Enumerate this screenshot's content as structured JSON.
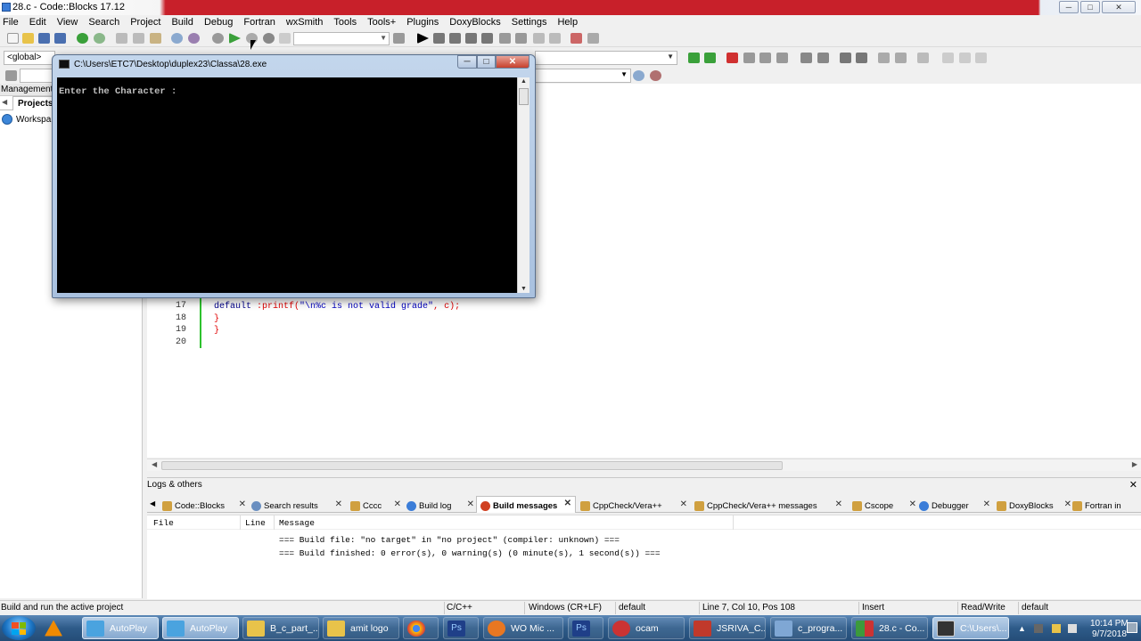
{
  "app": {
    "title": "28.c - Code::Blocks 17.12",
    "win_buttons": [
      "─",
      "□",
      "✕"
    ]
  },
  "menu": [
    "File",
    "Edit",
    "View",
    "Search",
    "Project",
    "Build",
    "Debug",
    "Fortran",
    "wxSmith",
    "Tools",
    "Tools+",
    "Plugins",
    "DoxyBlocks",
    "Settings",
    "Help"
  ],
  "toolbar": {
    "scope_value": "<global>"
  },
  "management": {
    "header": "Management",
    "tab_projects": "Projects",
    "workspace_label": "Workspa"
  },
  "editor": {
    "lines": [
      {
        "num": "17",
        "code_kw": "default",
        "code_rest": " :printf(",
        "code_str": "\"\\n%c is not valid grade\"",
        "code_end": ", c);"
      },
      {
        "num": "18",
        "brace": "}"
      },
      {
        "num": "19",
        "brace": "}"
      },
      {
        "num": "20",
        "brace": ""
      }
    ]
  },
  "logs": {
    "header": "Logs & others",
    "tabs": [
      {
        "label": "Code::Blocks",
        "icon_color": "#d0a040"
      },
      {
        "label": "Search results",
        "icon_color": "#6a8fc0"
      },
      {
        "label": "Cccc",
        "icon_color": "#d0a040"
      },
      {
        "label": "Build log",
        "icon_color": "#3b7dd8"
      },
      {
        "label": "Build messages",
        "icon_color": "#d04020"
      },
      {
        "label": "CppCheck/Vera++",
        "icon_color": "#d0a040"
      },
      {
        "label": "CppCheck/Vera++ messages",
        "icon_color": "#d0a040"
      },
      {
        "label": "Cscope",
        "icon_color": "#d0a040"
      },
      {
        "label": "Debugger",
        "icon_color": "#3b7dd8"
      },
      {
        "label": "DoxyBlocks",
        "icon_color": "#d0a040"
      },
      {
        "label": "Fortran in",
        "icon_color": "#d0a040"
      }
    ],
    "columns": [
      "File",
      "Line",
      "Message"
    ],
    "messages": [
      "=== Build file: \"no target\" in \"no project\" (compiler: unknown) ===",
      "=== Build finished: 0 error(s), 0 warning(s) (0 minute(s), 1 second(s)) ==="
    ]
  },
  "status": {
    "hint": "Build and run the active project",
    "language": "C/C++",
    "eol": "Windows (CR+LF)",
    "encoding": "default",
    "position": "Line 7, Col 10, Pos 108",
    "mode": "Insert",
    "access": "Read/Write",
    "profile": "default"
  },
  "console": {
    "title": "C:\\Users\\ETC7\\Desktop\\duplex23\\Classa\\28.exe",
    "output": "Enter the Character :"
  },
  "taskbar": {
    "items": [
      {
        "label": "AutoPlay",
        "icon_color": "#4aa3df",
        "active": true
      },
      {
        "label": "AutoPlay",
        "icon_color": "#4aa3df",
        "active": true
      },
      {
        "label": "B_c_part_...",
        "icon_color": "#e8c34a",
        "active": false
      },
      {
        "label": "amit logo",
        "icon_color": "#e8c34a",
        "active": false
      },
      {
        "label": "",
        "icon_color": "#db4437",
        "active": false
      },
      {
        "label": "",
        "icon_color": "#1f3f88",
        "active": false
      },
      {
        "label": "WO Mic ...",
        "icon_color": "#e87722",
        "active": false
      },
      {
        "label": "",
        "icon_color": "#1f3f88",
        "active": false
      },
      {
        "label": "ocam",
        "icon_color": "#c33",
        "active": false
      },
      {
        "label": "JSRIVA_C...",
        "icon_color": "#c0392b",
        "active": false
      },
      {
        "label": "c_progra...",
        "icon_color": "#7fa7d4",
        "active": false
      },
      {
        "label": "28.c - Co...",
        "icon_color": "#3c9a3c",
        "active": false
      },
      {
        "label": "C:\\Users\\...",
        "icon_color": "#333",
        "active": true
      }
    ],
    "time": "10:14 PM",
    "date": "9/7/2018"
  }
}
